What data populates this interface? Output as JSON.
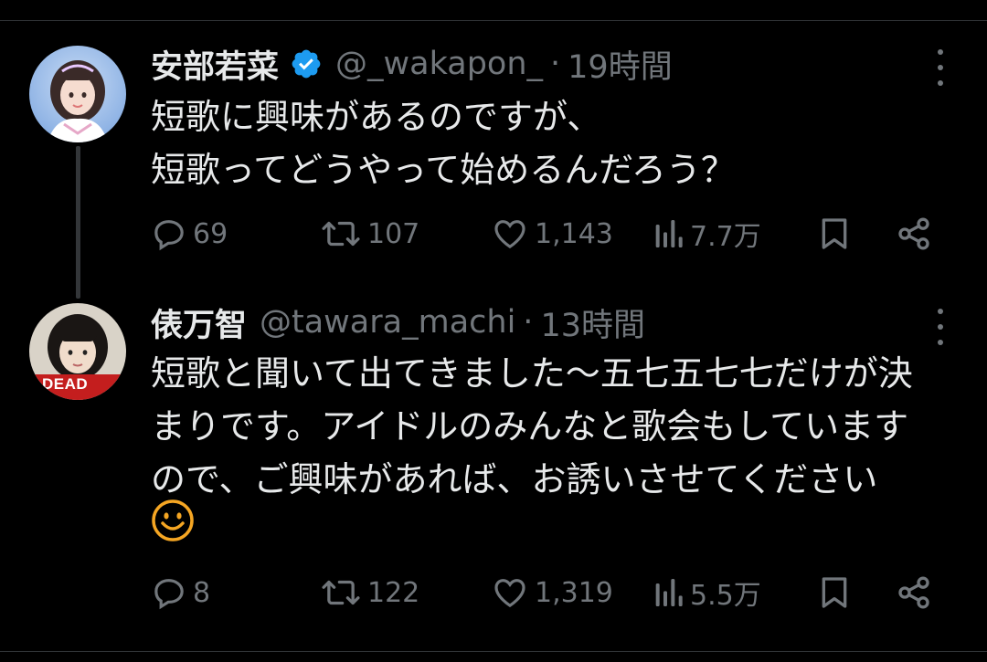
{
  "tweets": [
    {
      "name": "安部若菜",
      "handle": "@_wakapon_",
      "dot": "·",
      "time": "19時間",
      "text": "短歌に興味があるのですが、\n短歌ってどうやって始めるんだろう？",
      "replies": "69",
      "retweets": "107",
      "likes": "1,143",
      "views": "7.7万",
      "verified": true
    },
    {
      "name": "俵万智",
      "handle": "@tawara_machi",
      "dot": "·",
      "time": "13時間",
      "text": "短歌と聞いて出てきました〜五七五七七だけが決\nまりです。アイドルのみんなと歌会もしています\nので、ご興味があれば、お誘いさせてください",
      "emoji": "☺",
      "avatar_badge": "DEAD",
      "replies": "8",
      "retweets": "122",
      "likes": "1,319",
      "views": "5.5万"
    }
  ],
  "colors": {
    "background": "#000000",
    "text": "#e7e9ea",
    "muted": "#71767b",
    "verified": "#1d9bf0",
    "emoji": "#f5a623"
  },
  "icons": [
    "reply-icon",
    "retweet-icon",
    "like-icon",
    "views-icon",
    "bookmark-icon",
    "share-icon",
    "more-icon",
    "verified-icon",
    "smile-emoji-icon"
  ]
}
